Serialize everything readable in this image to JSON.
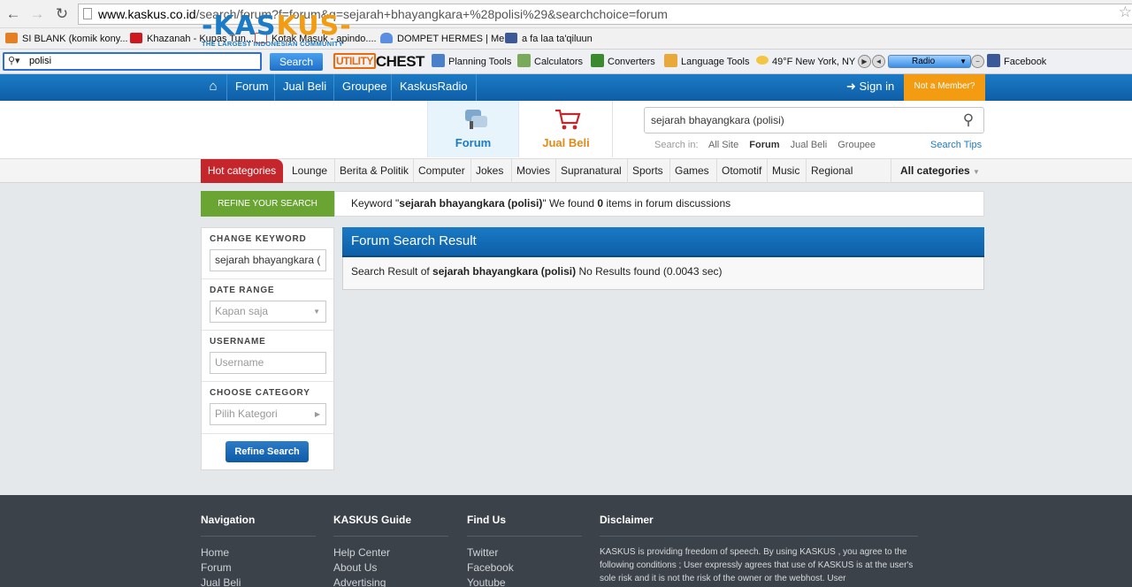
{
  "browser": {
    "url_host": "www.kaskus.co.id",
    "url_path": "/search/forum?f=forum&q=sejarah+bhayangkara+%28polisi%29&searchchoice=forum",
    "bookmarks": [
      {
        "label": "SI BLANK (komik kony...",
        "color": "#e67e22"
      },
      {
        "label": "Khazanah - Kupas Tun...",
        "color": "#cc181e"
      },
      {
        "label": "Kotak Masuk - apindo....",
        "color": "#d44638"
      },
      {
        "label": "DOMPET HERMES | Me...",
        "color": "#5a8ee0"
      },
      {
        "label": "a fa laa ta'qiluun",
        "color": "#3b5998"
      }
    ]
  },
  "toolbar": {
    "search_value": "polisi",
    "search_button": "Search",
    "brand_a": "UTILITY",
    "brand_b": "CHEST",
    "items": [
      "Planning Tools",
      "Calculators",
      "Converters",
      "Language Tools",
      "49°F New York, NY"
    ],
    "radio_label": "Radio",
    "facebook": "Facebook"
  },
  "topnav": {
    "items": [
      "Forum",
      "Jual Beli",
      "Groupee",
      "KaskusRadio"
    ],
    "signin": "Sign in",
    "member": "Not a Member?"
  },
  "logo": {
    "main_a": "-KAS",
    "main_b": "KUS-",
    "tagline": "THE LARGEST INDONESIAN COMMUNITY"
  },
  "tabs": {
    "forum": "Forum",
    "jualbeli": "Jual Beli"
  },
  "search": {
    "value": "sejarah bhayangkara (polisi)",
    "in_label": "Search in:",
    "options": [
      "All Site",
      "Forum",
      "Jual Beli",
      "Groupee"
    ],
    "tips": "Search Tips"
  },
  "categories": {
    "hot": "Hot categories",
    "items": [
      "Lounge",
      "Berita & Politik",
      "Computer",
      "Jokes",
      "Movies",
      "Supranatural",
      "Sports",
      "Games",
      "Otomotif",
      "Music",
      "Regional"
    ],
    "all": "All categories"
  },
  "refine": {
    "header": "REFINE YOUR SEARCH",
    "keyword_label": "CHANGE KEYWORD",
    "keyword_value": "sejarah bhayangkara (",
    "date_label": "DATE RANGE",
    "date_value": "Kapan saja",
    "username_label": "USERNAME",
    "username_placeholder": "Username",
    "category_label": "CHOOSE CATEGORY",
    "category_value": "Pilih Kategori",
    "button": "Refine Search"
  },
  "keywordbar": {
    "pre": "Keyword \"",
    "keyword": "sejarah bhayangkara (polisi)",
    "mid": "\" We found ",
    "count": "0",
    "post": " items in forum discussions"
  },
  "result": {
    "title": "Forum Search Result",
    "pre": "Search Result of ",
    "keyword": "sejarah bhayangkara (polisi)",
    "post": " No Results found (0.0043 sec)"
  },
  "footer": {
    "navigation": {
      "title": "Navigation",
      "links": [
        "Home",
        "Forum",
        "Jual Beli"
      ]
    },
    "guide": {
      "title": "KASKUS Guide",
      "links": [
        "Help Center",
        "About Us",
        "Advertising"
      ]
    },
    "findus": {
      "title": "Find Us",
      "links": [
        "Twitter",
        "Facebook",
        "Youtube"
      ]
    },
    "disclaimer": {
      "title": "Disclaimer",
      "text": "KASKUS is providing freedom of speech. By using KASKUS , you agree to the following conditions ; User expressly agrees that use of KASKUS is at the user's sole risk and it is not the risk of the owner or the webhost. User"
    }
  }
}
